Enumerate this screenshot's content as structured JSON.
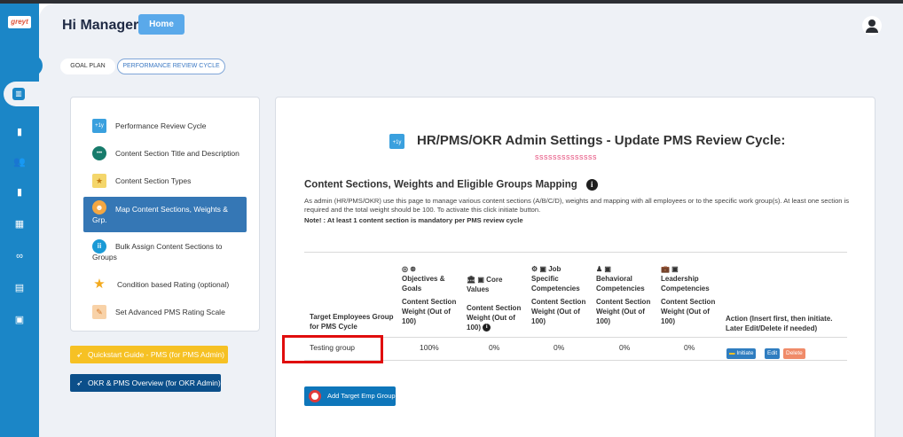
{
  "app": {
    "logo_text": "greyt"
  },
  "header": {
    "greeting": "Hi Manager",
    "home_label": "Home"
  },
  "tabs": [
    {
      "label": "GOAL PLAN"
    },
    {
      "label": "PERFORMANCE REVIEW CYCLE"
    }
  ],
  "rail": {
    "icons": [
      "dashboard-icon",
      "book-icon",
      "people-icon",
      "book-icon",
      "chart-icon",
      "handshake-icon",
      "form-icon",
      "calendar-icon"
    ]
  },
  "sidebar": {
    "items": [
      {
        "label": "Performance Review Cycle",
        "icon": "calendar-icon"
      },
      {
        "label": "Content Section Title and Description",
        "icon": "dots-icon"
      },
      {
        "label": "Content Section Types",
        "icon": "star-badge-icon"
      },
      {
        "label": "Map Content Sections, Weights & Grp.",
        "icon": "people-map-icon"
      },
      {
        "label": "Bulk Assign Content Sections to Groups",
        "icon": "group-icon"
      },
      {
        "label": "Condition based Rating (optional)",
        "icon": "star-icon"
      },
      {
        "label": "Set Advanced PMS Rating Scale",
        "icon": "ruler-icon"
      }
    ]
  },
  "buttons": {
    "quickstart": "Quickstart Guide - PMS (for PMS Admin)",
    "okr_overview": "OKR & PMS Overview (for OKR Admin)"
  },
  "panel": {
    "title": "HR/PMS/OKR Admin Settings - Update PMS Review Cycle:",
    "cal_badge": "+1y",
    "subtitle": "ssssssssssssss",
    "section_title": "Content Sections, Weights and Eligible Groups Mapping",
    "description": "As admin (HR/PMS/OKR) use this page to manage various content sections (A/B/C/D), weights and mapping with all employees or to the specific work group(s). At least one section is required and the total weight should be 100. To activate this click initiate button.",
    "note": "Note! : At least 1 content section is mandatory per PMS review cycle",
    "table": {
      "first_col": "Target Employees Group for PMS Cycle",
      "sections": [
        {
          "name": "Objectives & Goals",
          "weight_label": "Content Section Weight (Out of 100)"
        },
        {
          "name": "Core Values",
          "weight_label": "Content Section Weight (Out of 100)"
        },
        {
          "name": "Job Specific Competencies",
          "weight_label": "Content Section Weight (Out of 100)"
        },
        {
          "name": "Behavioral Competencies",
          "weight_label": "Content Section Weight (Out of 100)"
        },
        {
          "name": "Leadership Competencies",
          "weight_label": "Content Section Weight (Out of 100)"
        }
      ],
      "action_col": "Action (Insert first, then initiate. Later Edit/Delete if needed)",
      "rows": [
        {
          "group": "Testing group",
          "values": [
            "100%",
            "0%",
            "0%",
            "0%",
            "0%"
          ]
        }
      ],
      "actions": {
        "initiate": "Initiate",
        "edit": "Edit",
        "delete": "Delete"
      }
    },
    "add_button": "Add Target Emp Group"
  }
}
